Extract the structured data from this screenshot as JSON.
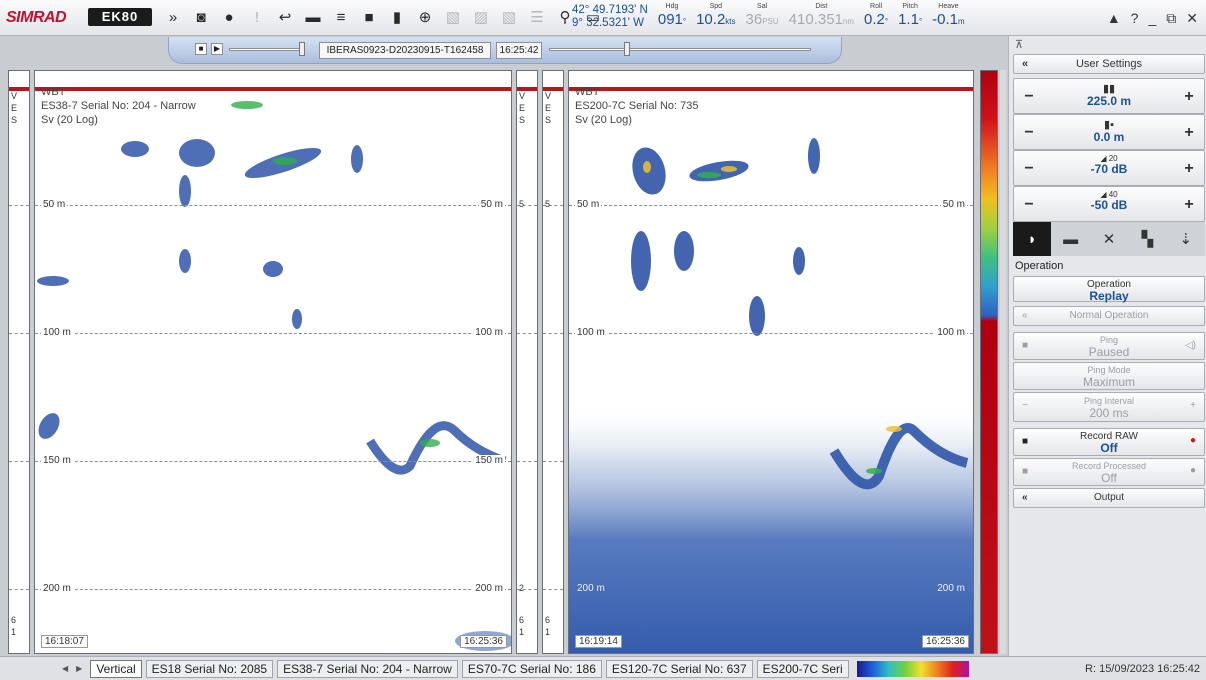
{
  "app": {
    "brand": "SIMRAD",
    "product": "EK80"
  },
  "nav": {
    "lat": "42° 49.7193' N",
    "lon": "9° 32.5321' W",
    "hdg_label": "Hdg",
    "hdg": "091",
    "hdg_unit": "°",
    "spd_label": "Spd",
    "spd": "10.2",
    "spd_unit": "kts",
    "sal_label": "Sal",
    "sal": "36",
    "sal_unit": "PSU",
    "dist_label": "Dist",
    "dist": "410.351",
    "dist_unit": "nm",
    "roll_label": "Roll",
    "roll": "0.2",
    "roll_unit": "°",
    "pitch_label": "Pitch",
    "pitch": "1.1",
    "pitch_unit": "°",
    "heave_label": "Heave",
    "heave": "-0.1",
    "heave_unit": "m"
  },
  "window": {
    "warn": "▲",
    "help": "?",
    "min": "_",
    "max": "⧉",
    "close": "✕"
  },
  "replay": {
    "file": "IBERAS0923-D20230915-T162458",
    "time": "16:25:42"
  },
  "echo1": {
    "label_wbt": "WBT",
    "title": "ES38-7 Serial No: 204 - Narrow",
    "mode": "Sv (20 Log)",
    "d50": "50 m",
    "d100": "100 m",
    "d150": "150 m",
    "d200": "200 m",
    "t_start": "16:18:07",
    "t_end": "16:25:36"
  },
  "echo2": {
    "label_wbt": "WBT",
    "title": "ES200-7C Serial No: 735",
    "mode": "Sv (20 Log)",
    "d50": "50 m",
    "d100": "100 m",
    "d200": "200 m",
    "t_start": "16:19:14",
    "t_end": "16:25:36"
  },
  "thin": {
    "v": "V",
    "e": "E",
    "s": "S",
    "n6": "6",
    "n1": "1",
    "n5": "5",
    "n2": "2"
  },
  "panel": {
    "collapse": "«",
    "user_settings": "User Settings",
    "range": "225.0 m",
    "start": "0.0 m",
    "gain1_sup": "20",
    "gain1": "-70 dB",
    "gain2_sup": "40",
    "gain2": "-50 dB",
    "minus": "−",
    "plus": "+",
    "operation_hdr": "Operation",
    "op_label": "Operation",
    "op_val": "Replay",
    "normal_op": "Normal Operation",
    "ping_label": "Ping",
    "ping_val": "Paused",
    "pingmode_label": "Ping Mode",
    "pingmode_val": "Maximum",
    "pinginterval_label": "Ping Interval",
    "pinginterval_val": "200 ms",
    "recraw_label": "Record RAW",
    "recraw_val": "Off",
    "recproc_label": "Record Processed",
    "recproc_val": "Off",
    "output": "Output"
  },
  "status": {
    "tabs": [
      "Vertical",
      "ES18 Serial No: 2085",
      "ES38-7 Serial No: 204 - Narrow",
      "ES70-7C Serial No: 186",
      "ES120-7C Serial No: 637",
      "ES200-7C Seri"
    ],
    "record": "R: 15/09/2023  16:25:42"
  }
}
